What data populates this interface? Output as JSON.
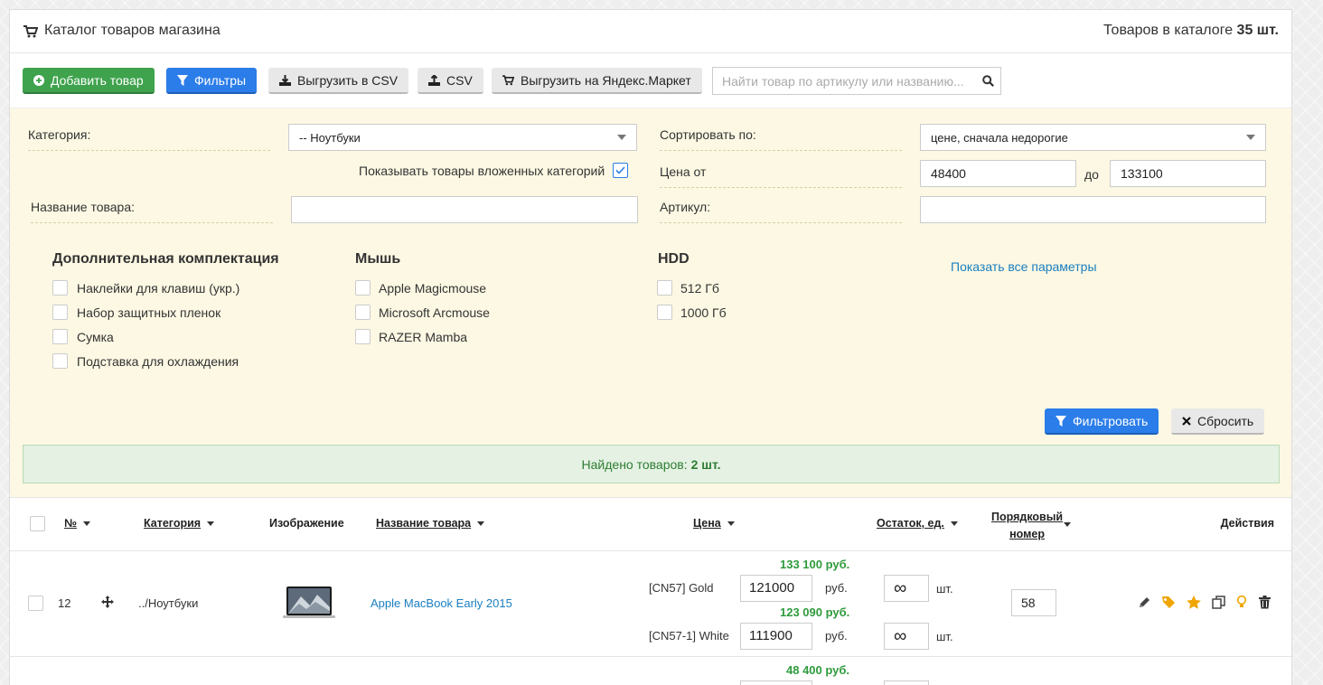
{
  "header": {
    "title": "Каталог товаров магазина",
    "count_prefix": "Товаров в каталоге",
    "count_value": "35 шт."
  },
  "toolbar": {
    "add_label": "Добавить товар",
    "filters_label": "Фильтры",
    "export_csv_label": "Выгрузить в CSV",
    "import_csv_label": "CSV",
    "yandex_label": "Выгрузить на Яндекс.Маркет",
    "search_placeholder": "Найти товар по артикулу или названию..."
  },
  "filters": {
    "category_label": "Категория:",
    "category_value": "-- Ноутбуки",
    "nested_label": "Показывать товары вложенных категорий",
    "nested_checked": true,
    "name_label": "Название товара:",
    "name_value": "",
    "sort_label": "Сортировать по:",
    "sort_value": "цене, сначала недорогие",
    "price_from_label": "Цена от",
    "price_from": "48400",
    "price_to_label": "до",
    "price_to": "133100",
    "sku_label": "Артикул:",
    "sku_value": "",
    "params": [
      {
        "title": "Дополнительная комплектация",
        "items": [
          "Наклейки для клавиш (укр.)",
          "Набор защитных пленок",
          "Сумка",
          "Подставка для охлаждения"
        ]
      },
      {
        "title": "Мышь",
        "items": [
          "Apple Magicmouse",
          "Microsoft Arcmouse",
          "RAZER Mamba"
        ]
      },
      {
        "title": "HDD",
        "items": [
          "512 Гб",
          "1000 Гб"
        ]
      }
    ],
    "show_all_label": "Показать все параметры",
    "apply_label": "Фильтровать",
    "reset_label": "Сбросить"
  },
  "found": {
    "prefix": "Найдено товаров:",
    "value": "2 шт."
  },
  "table": {
    "headers": {
      "num": "№",
      "category": "Категория",
      "image": "Изображение",
      "name": "Название товара",
      "price": "Цена",
      "stock": "Остаток, ед.",
      "order_line1": "Порядковый",
      "order_line2": "номер",
      "actions": "Действия"
    },
    "rows": [
      {
        "num": "12",
        "category": "../Ноутбуки",
        "name": "Apple MacBook Early 2015",
        "order": "58",
        "variants": [
          {
            "sum": "133 100 руб.",
            "label": "[CN57] Gold",
            "price": "121000",
            "currency": "руб.",
            "stock": "∞",
            "unit": "шт."
          },
          {
            "sum": "123 090 руб.",
            "label": "[CN57-1] White",
            "price": "111900",
            "currency": "руб.",
            "stock": "∞",
            "unit": "шт."
          }
        ]
      },
      {
        "variants": [
          {
            "sum": "48 400 руб."
          }
        ]
      }
    ]
  },
  "colors": {
    "green": "#3fa34d",
    "blue": "#2b7de9",
    "panel_bg": "#fcf8e3",
    "price_green": "#2e9b3c",
    "link": "#1a7fc1"
  }
}
